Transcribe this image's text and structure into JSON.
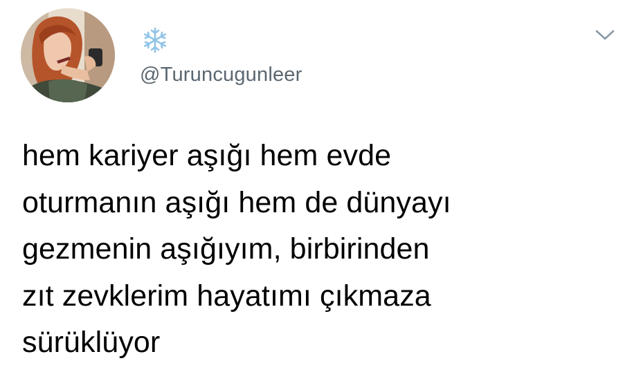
{
  "tweet": {
    "display_name_icon": "snowflake-icon",
    "handle": "@Turuncugunleer",
    "menu_icon": "chevron-down-icon",
    "text_lines": [
      "hem kariyer aşığı hem evde",
      "oturmanın aşığı hem de dünyayı",
      "gezmenin aşığıyım, birbirinden",
      "zıt zevklerim hayatımı çıkmaza",
      "sürüklüyor"
    ]
  },
  "colors": {
    "handle": "#5b6770",
    "text": "#000000",
    "snowflake": "#8fc3e8",
    "chevron": "#8899a6"
  }
}
